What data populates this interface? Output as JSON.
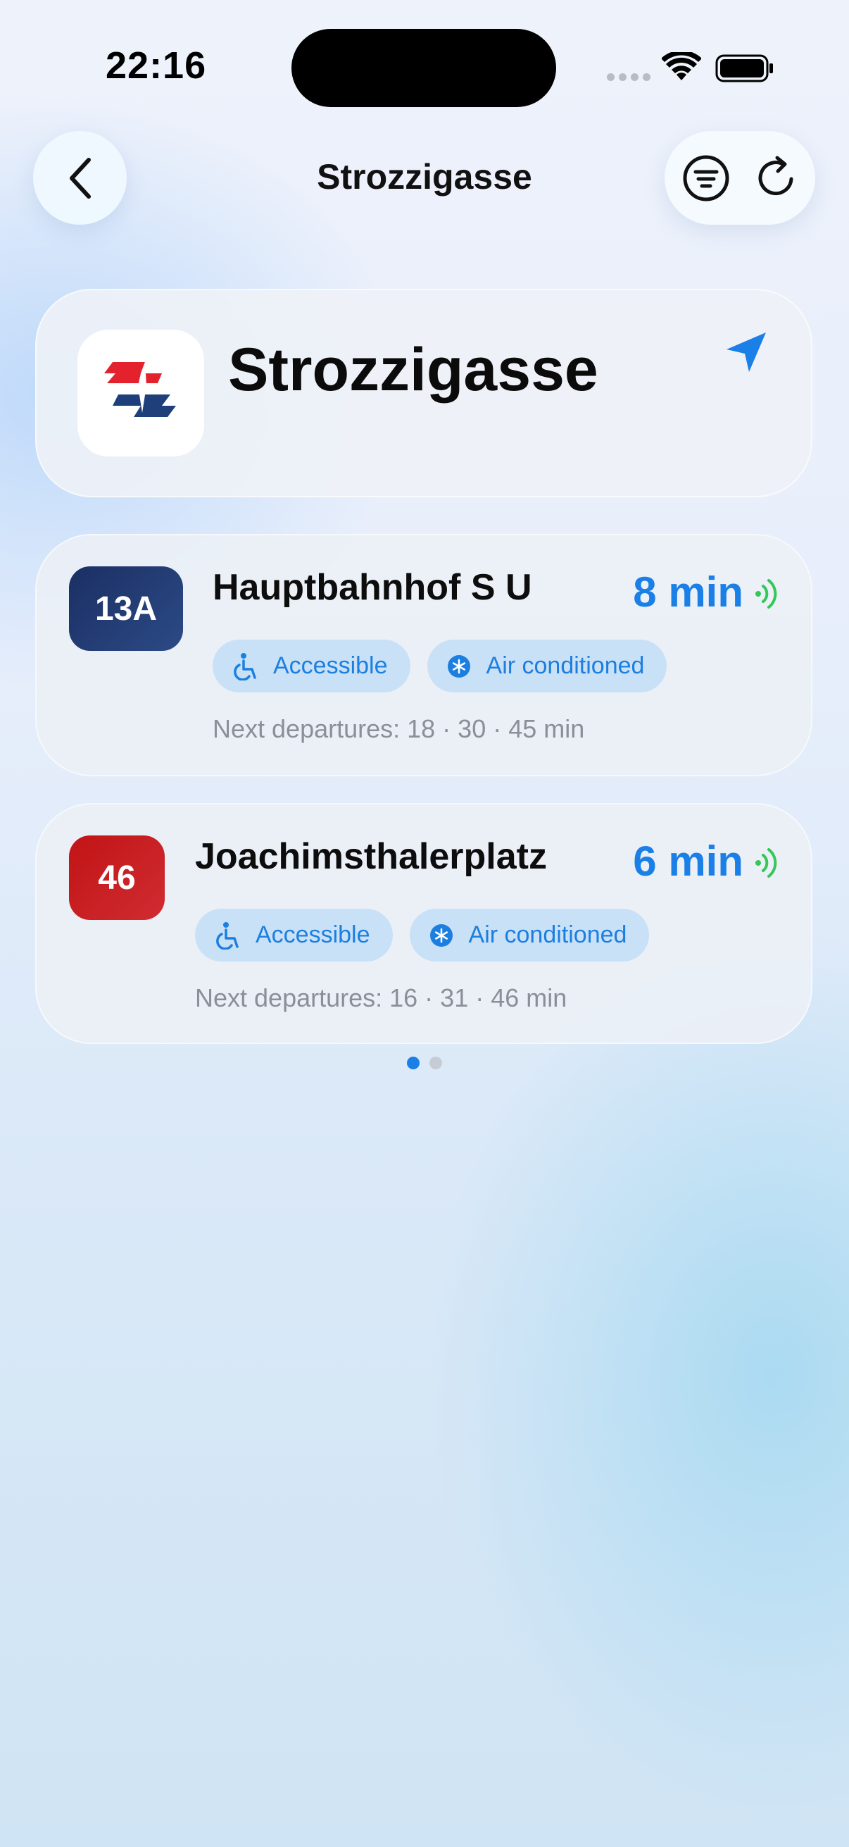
{
  "status_bar": {
    "time": "22:16"
  },
  "nav": {
    "title": "Strozzigasse",
    "back_icon": "chevron-left-icon",
    "filter_icon": "filter-icon",
    "refresh_icon": "refresh-icon"
  },
  "station": {
    "name": "Strozzigasse",
    "logo": "transit-operator-logo",
    "location_icon": "location-arrow-icon"
  },
  "departures": [
    {
      "line": "13A",
      "line_color": "#1f3a73",
      "destination": "Hauptbahnhof S U",
      "eta": "8 min",
      "features": [
        {
          "icon": "wheelchair-icon",
          "label": "Accessible"
        },
        {
          "icon": "snowflake-icon",
          "label": "Air conditioned"
        }
      ],
      "next_departures": "Next departures: 18 · 30 · 45 min"
    },
    {
      "line": "46",
      "line_color": "#c8191c",
      "destination": "Joachimsthalerplatz",
      "eta": "6 min",
      "features": [
        {
          "icon": "wheelchair-icon",
          "label": "Accessible"
        },
        {
          "icon": "snowflake-icon",
          "label": "Air conditioned"
        }
      ],
      "next_departures": "Next departures: 16 · 31 · 46 min"
    }
  ],
  "pagination": {
    "pages": 2,
    "current": 1
  },
  "colors": {
    "accent": "#1a7fe6",
    "realtime": "#34c759",
    "chip_bg": "#c9e1f7"
  }
}
